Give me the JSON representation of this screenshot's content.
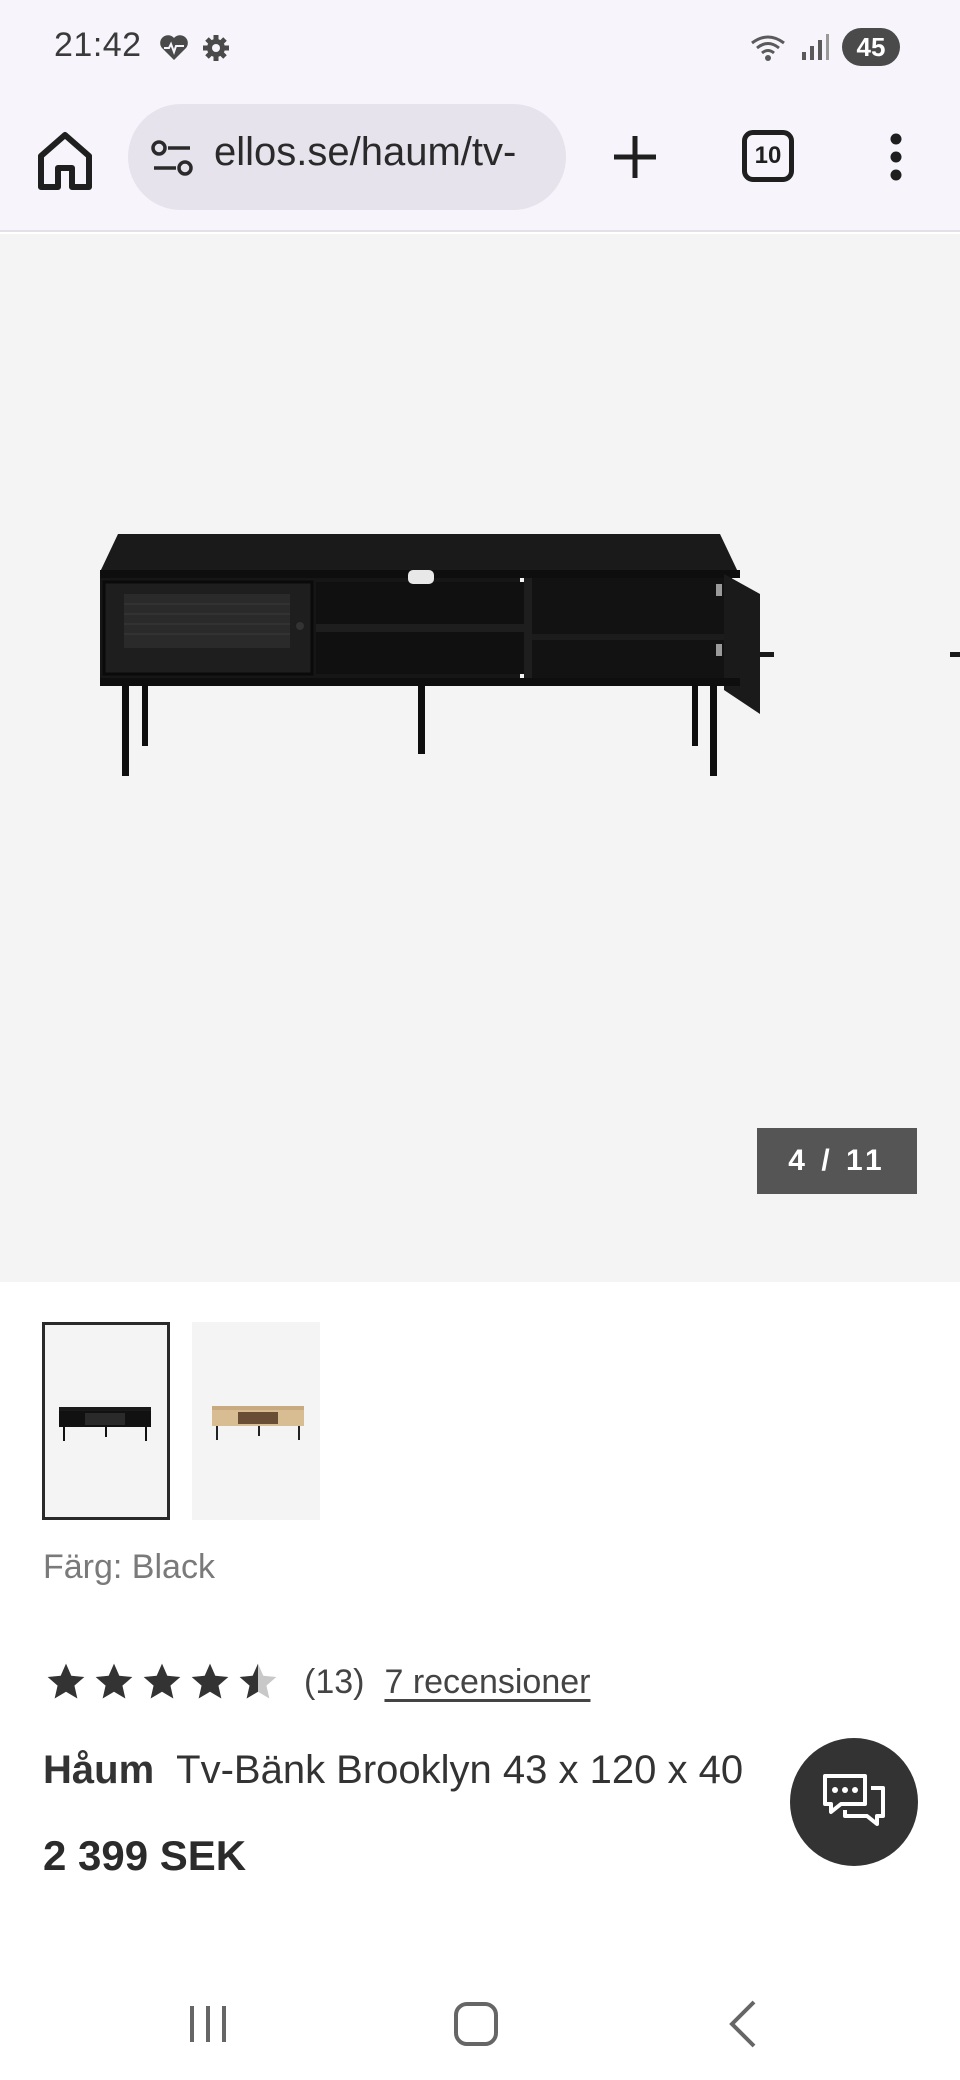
{
  "status_bar": {
    "time": "21:42",
    "left_icons": [
      "heart-pulse-icon",
      "gear-icon"
    ],
    "right_icons": [
      "wifi-icon",
      "signal-icon"
    ],
    "battery": "45"
  },
  "browser": {
    "url": "ellos.se/haum/tv-",
    "tab_count": "10"
  },
  "gallery": {
    "counter": "4 / 11",
    "current_index": 4,
    "total": 11,
    "thumbnails": [
      "black-tv-bench",
      "oak-tv-bench"
    ]
  },
  "product": {
    "color_label": "Färg: Black",
    "rating_value": 4.5,
    "rating_count": "(13)",
    "reviews_link": "7 recensioner",
    "brand": "Håum",
    "name": "Tv-Bänk Brooklyn 43 x 120 x 40",
    "price": "2 399 SEK"
  },
  "colors": {
    "background": "#ffffff",
    "image_bg": "#f4f4f4",
    "counter_bg": "#555555",
    "chat_bg": "#333333"
  }
}
